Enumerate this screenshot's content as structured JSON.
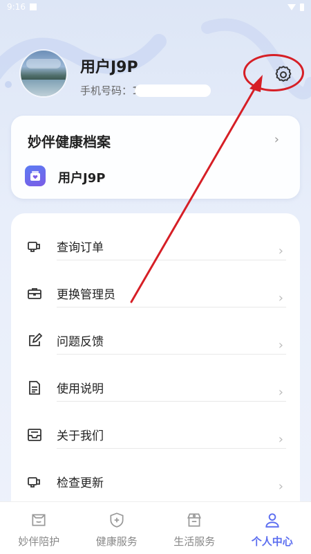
{
  "status_bar": {
    "time": "9:16"
  },
  "profile": {
    "name": "用户J9P",
    "phone_label": "手机号码：",
    "phone_visible": "1"
  },
  "health_card": {
    "title": "妙伴健康档案",
    "user_name": "用户J9P"
  },
  "menu": {
    "items": [
      {
        "label": "查询订单",
        "icon": "order-search-icon"
      },
      {
        "label": "更换管理员",
        "icon": "briefcase-icon"
      },
      {
        "label": "问题反馈",
        "icon": "edit-feedback-icon"
      },
      {
        "label": "使用说明",
        "icon": "document-icon"
      },
      {
        "label": "关于我们",
        "icon": "inbox-icon"
      },
      {
        "label": "检查更新",
        "icon": "update-icon"
      }
    ]
  },
  "tabbar": {
    "tabs": [
      {
        "label": "妙伴陪护",
        "icon": "companion-icon"
      },
      {
        "label": "健康服务",
        "icon": "shield-plus-icon"
      },
      {
        "label": "生活服务",
        "icon": "shop-icon"
      },
      {
        "label": "个人中心",
        "icon": "person-icon"
      }
    ],
    "active_index": 3
  },
  "colors": {
    "accent": "#5b6df0",
    "annotation": "#d61f26",
    "health_icon": "#6a6cf0"
  }
}
